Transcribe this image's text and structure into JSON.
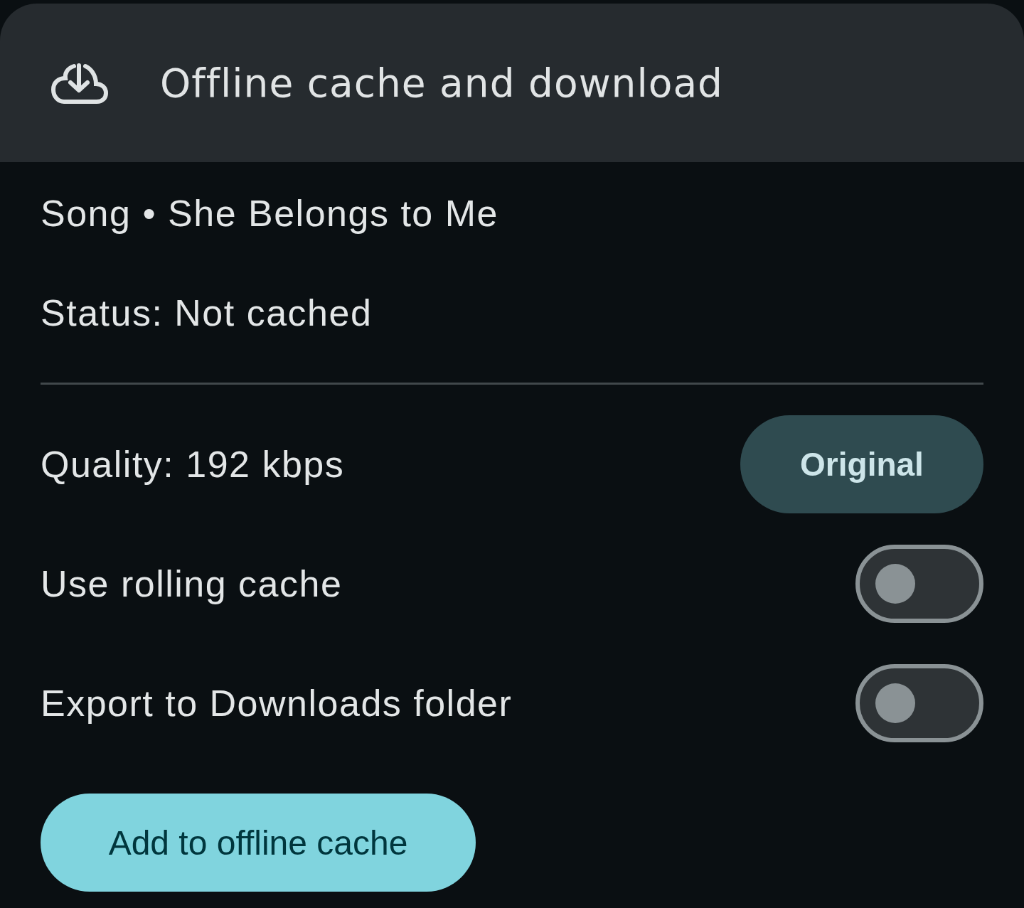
{
  "header": {
    "title": "Offline cache and download"
  },
  "info": [
    "Song • She Belongs to Me",
    "Status: Not cached"
  ],
  "settings": [
    {
      "kind": "button",
      "label": "Quality: 192 kbps",
      "button": "Original"
    },
    {
      "kind": "switch",
      "label": "Use rolling cache",
      "on": false
    },
    {
      "kind": "switch",
      "label": "Export to Downloads folder",
      "on": false
    }
  ],
  "action": "Add to offline cache"
}
